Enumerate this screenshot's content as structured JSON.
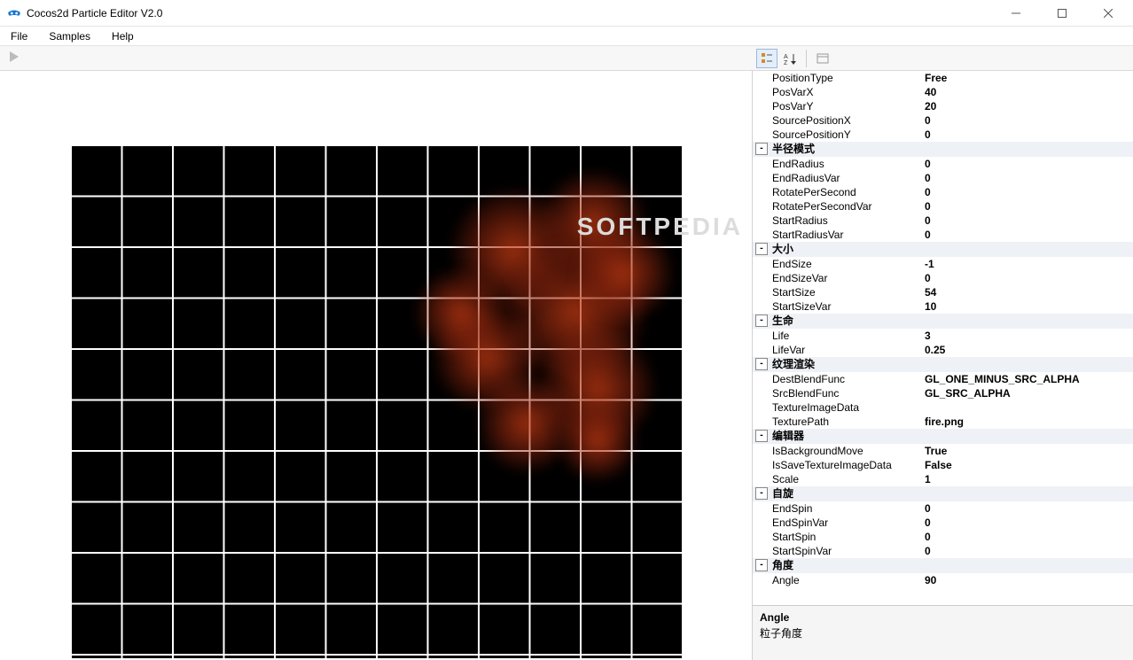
{
  "app": {
    "title": "Cocos2d Particle Editor V2.0"
  },
  "menu": {
    "file": "File",
    "samples": "Samples",
    "help": "Help"
  },
  "watermark": "SOFTPEDIA",
  "propertyGrid": {
    "topProperties": [
      {
        "label": "PositionType",
        "value": "Free"
      },
      {
        "label": "PosVarX",
        "value": "40"
      },
      {
        "label": "PosVarY",
        "value": "20"
      },
      {
        "label": "SourcePositionX",
        "value": "0"
      },
      {
        "label": "SourcePositionY",
        "value": "0"
      }
    ],
    "categories": [
      {
        "name": "半径模式",
        "props": [
          {
            "label": "EndRadius",
            "value": "0"
          },
          {
            "label": "EndRadiusVar",
            "value": "0"
          },
          {
            "label": "RotatePerSecond",
            "value": "0"
          },
          {
            "label": "RotatePerSecondVar",
            "value": "0"
          },
          {
            "label": "StartRadius",
            "value": "0"
          },
          {
            "label": "StartRadiusVar",
            "value": "0"
          }
        ]
      },
      {
        "name": "大小",
        "props": [
          {
            "label": "EndSize",
            "value": "-1"
          },
          {
            "label": "EndSizeVar",
            "value": "0"
          },
          {
            "label": "StartSize",
            "value": "54"
          },
          {
            "label": "StartSizeVar",
            "value": "10"
          }
        ]
      },
      {
        "name": "生命",
        "props": [
          {
            "label": "Life",
            "value": "3"
          },
          {
            "label": "LifeVar",
            "value": "0.25"
          }
        ]
      },
      {
        "name": "纹理渲染",
        "props": [
          {
            "label": "DestBlendFunc",
            "value": "GL_ONE_MINUS_SRC_ALPHA"
          },
          {
            "label": "SrcBlendFunc",
            "value": "GL_SRC_ALPHA"
          },
          {
            "label": "TextureImageData",
            "value": ""
          },
          {
            "label": "TexturePath",
            "value": "fire.png"
          }
        ]
      },
      {
        "name": "编辑器",
        "props": [
          {
            "label": "IsBackgroundMove",
            "value": "True"
          },
          {
            "label": "IsSaveTextureImageData",
            "value": "False"
          },
          {
            "label": "Scale",
            "value": "1"
          }
        ]
      },
      {
        "name": "自旋",
        "props": [
          {
            "label": "EndSpin",
            "value": "0"
          },
          {
            "label": "EndSpinVar",
            "value": "0"
          },
          {
            "label": "StartSpin",
            "value": "0"
          },
          {
            "label": "StartSpinVar",
            "value": "0"
          }
        ]
      },
      {
        "name": "角度",
        "props": [
          {
            "label": "Angle",
            "value": "90"
          }
        ]
      }
    ],
    "description": {
      "title": "Angle",
      "body": "粒子角度"
    }
  }
}
